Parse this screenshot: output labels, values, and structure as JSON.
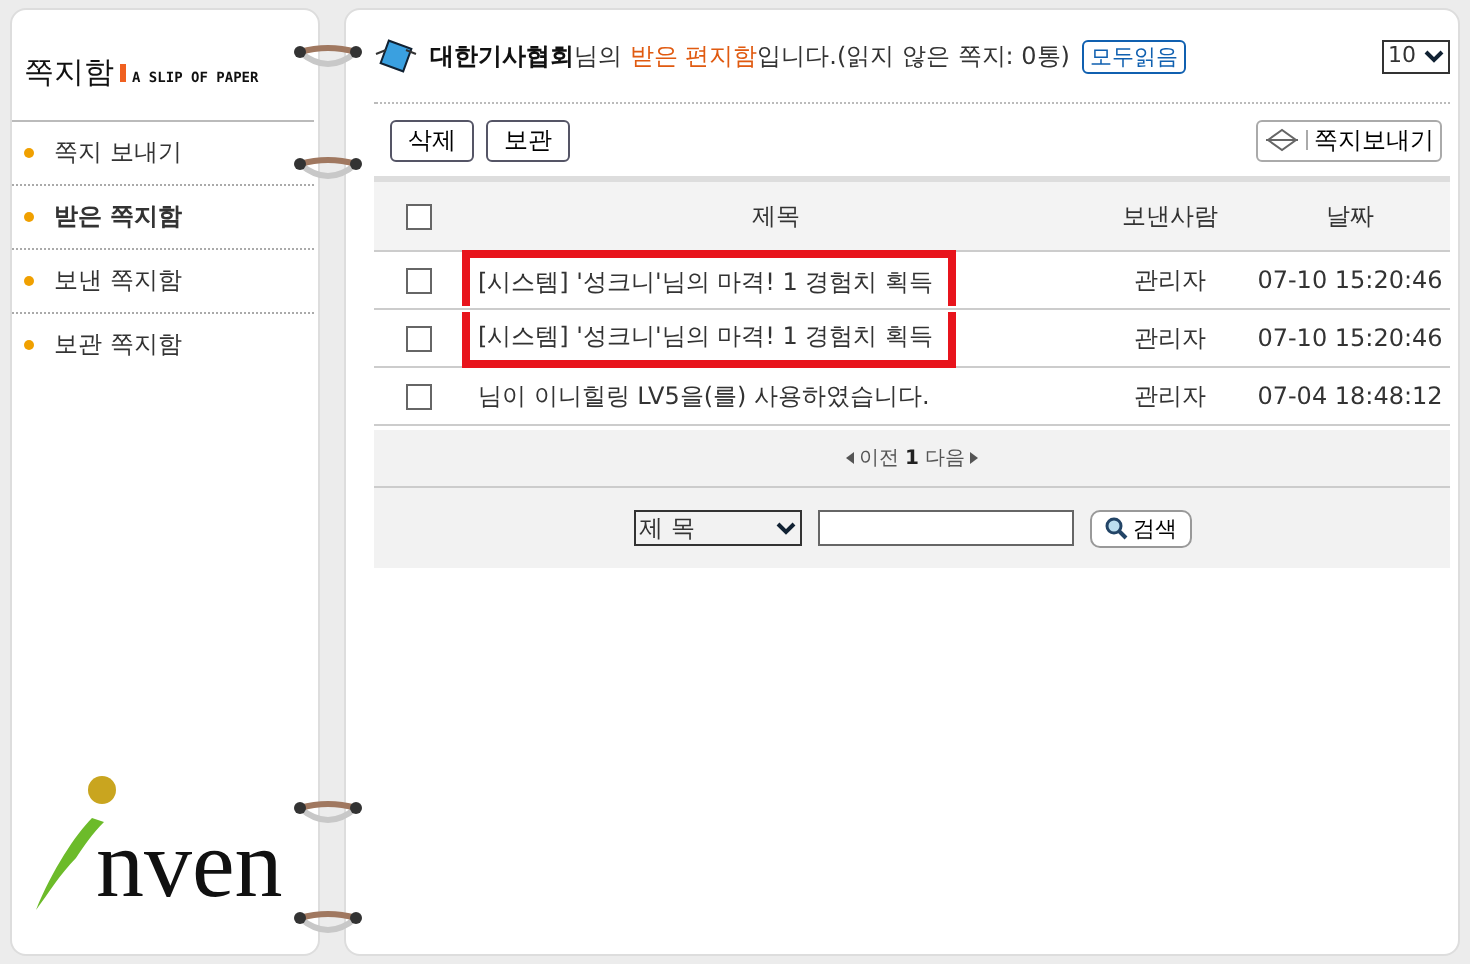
{
  "sidebar": {
    "title": "쪽지함",
    "subtitle": "A SLIP OF PAPER",
    "items": [
      {
        "label": "쪽지 보내기",
        "selected": false
      },
      {
        "label": "받은 쪽지함",
        "selected": true
      },
      {
        "label": "보낸 쪽지함",
        "selected": false
      },
      {
        "label": "보관 쪽지함",
        "selected": false
      }
    ],
    "logo": "nven"
  },
  "header": {
    "user": "대한기사협회",
    "text1": "님의 ",
    "box": "받은 편지함",
    "text2": "입니다.(읽지 않은 쪽지: 0통)",
    "read_all": "모두읽음",
    "page_size": "10"
  },
  "toolbar": {
    "delete": "삭제",
    "archive": "보관",
    "compose": "쪽지보내기"
  },
  "table": {
    "select_all_checked": false,
    "columns": [
      "제목",
      "보낸사람",
      "날짜"
    ],
    "rows": [
      {
        "checked": false,
        "highlighted": true,
        "title": "[시스템] '성크니'님의 마격! 1 경험치 획득",
        "sender": "관리자",
        "date": "07-10 15:20:46"
      },
      {
        "checked": false,
        "highlighted": true,
        "title": "[시스템] '성크니'님의 마격! 1 경험치 획득",
        "sender": "관리자",
        "date": "07-10 15:20:46"
      },
      {
        "checked": false,
        "highlighted": false,
        "title": "님이 이니힐링 LV5을(를) 사용하였습니다.",
        "sender": "관리자",
        "date": "07-04 18:48:12"
      }
    ]
  },
  "pagination": {
    "prev": "이전",
    "page": "1",
    "next": "다음"
  },
  "search": {
    "field": "제 목",
    "button": "검색"
  }
}
